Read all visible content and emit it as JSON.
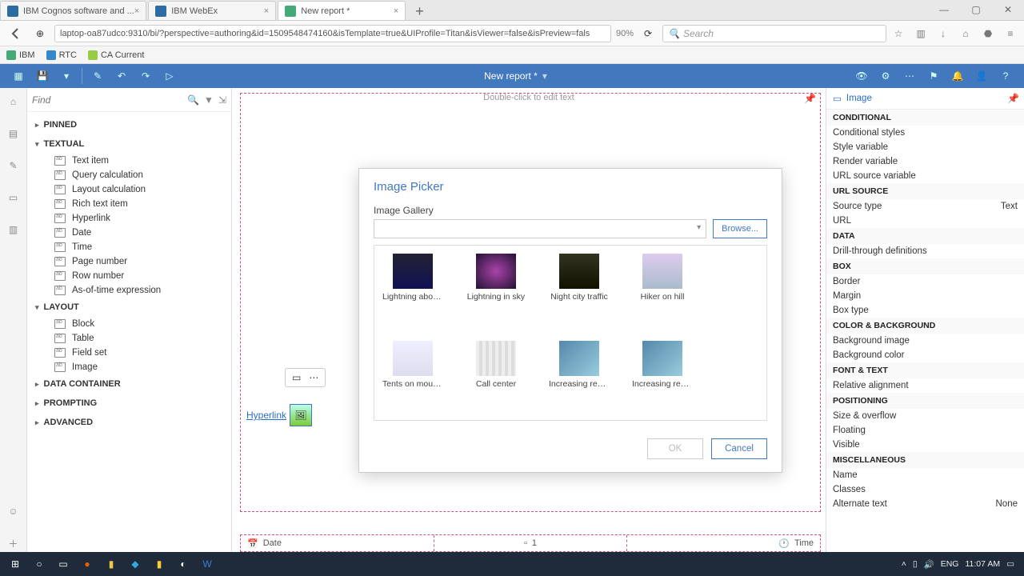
{
  "browser": {
    "tabs": [
      {
        "title": "IBM Cognos software and ..."
      },
      {
        "title": "IBM WebEx"
      },
      {
        "title": "New report *"
      }
    ],
    "url": "laptop-oa87udco:9310/bi/?perspective=authoring&id=1509548474160&isTemplate=true&UIProfile=Titan&isViewer=false&isPreview=fals",
    "zoom": "90%",
    "search_placeholder": "Search",
    "bookmarks": [
      "IBM",
      "RTC",
      "CA Current"
    ]
  },
  "app": {
    "title": "New report *"
  },
  "left": {
    "find_placeholder": "Find",
    "groups": {
      "pinned": "PINNED",
      "textual": "TEXTUAL",
      "layout": "LAYOUT",
      "data_container": "DATA CONTAINER",
      "prompting": "PROMPTING",
      "advanced": "ADVANCED"
    },
    "textual_items": [
      "Text item",
      "Query calculation",
      "Layout calculation",
      "Rich text item",
      "Hyperlink",
      "Date",
      "Time",
      "Page number",
      "Row number",
      "As-of-time expression"
    ],
    "layout_items": [
      "Block",
      "Table",
      "Field set",
      "Image"
    ]
  },
  "canvas": {
    "edit_hint": "Double-click to edit text",
    "hyperlink_label": "Hyperlink",
    "footer": {
      "date": "Date",
      "page": "1",
      "time": "Time"
    }
  },
  "dialog": {
    "title": "Image Picker",
    "gallery_label": "Image Gallery",
    "browse": "Browse...",
    "ok": "OK",
    "cancel": "Cancel",
    "thumbs": [
      "Lightning above city",
      "Lightning in sky",
      "Night city traffic",
      "Hiker on hill",
      "Tents on mountain",
      "Call center",
      "Increasing revenu...",
      "Increasing revenue"
    ]
  },
  "right": {
    "object": "Image",
    "sections": {
      "conditional": "CONDITIONAL",
      "url_source": "URL SOURCE",
      "data": "DATA",
      "box": "BOX",
      "color_bg": "COLOR & BACKGROUND",
      "font_text": "FONT & TEXT",
      "positioning": "POSITIONING",
      "misc": "MISCELLANEOUS"
    },
    "props": {
      "conditional_styles": "Conditional styles",
      "style_variable": "Style variable",
      "render_variable": "Render variable",
      "url_source_variable": "URL source variable",
      "source_type": "Source type",
      "source_type_val": "Text",
      "url": "URL",
      "drill": "Drill-through definitions",
      "border": "Border",
      "margin": "Margin",
      "box_type": "Box type",
      "bg_image": "Background image",
      "bg_color": "Background color",
      "rel_align": "Relative alignment",
      "size_overflow": "Size & overflow",
      "floating": "Floating",
      "visible": "Visible",
      "name": "Name",
      "classes": "Classes",
      "alt_text": "Alternate text",
      "alt_text_val": "None"
    }
  },
  "taskbar": {
    "lang": "ENG",
    "time": "11:07 AM"
  }
}
